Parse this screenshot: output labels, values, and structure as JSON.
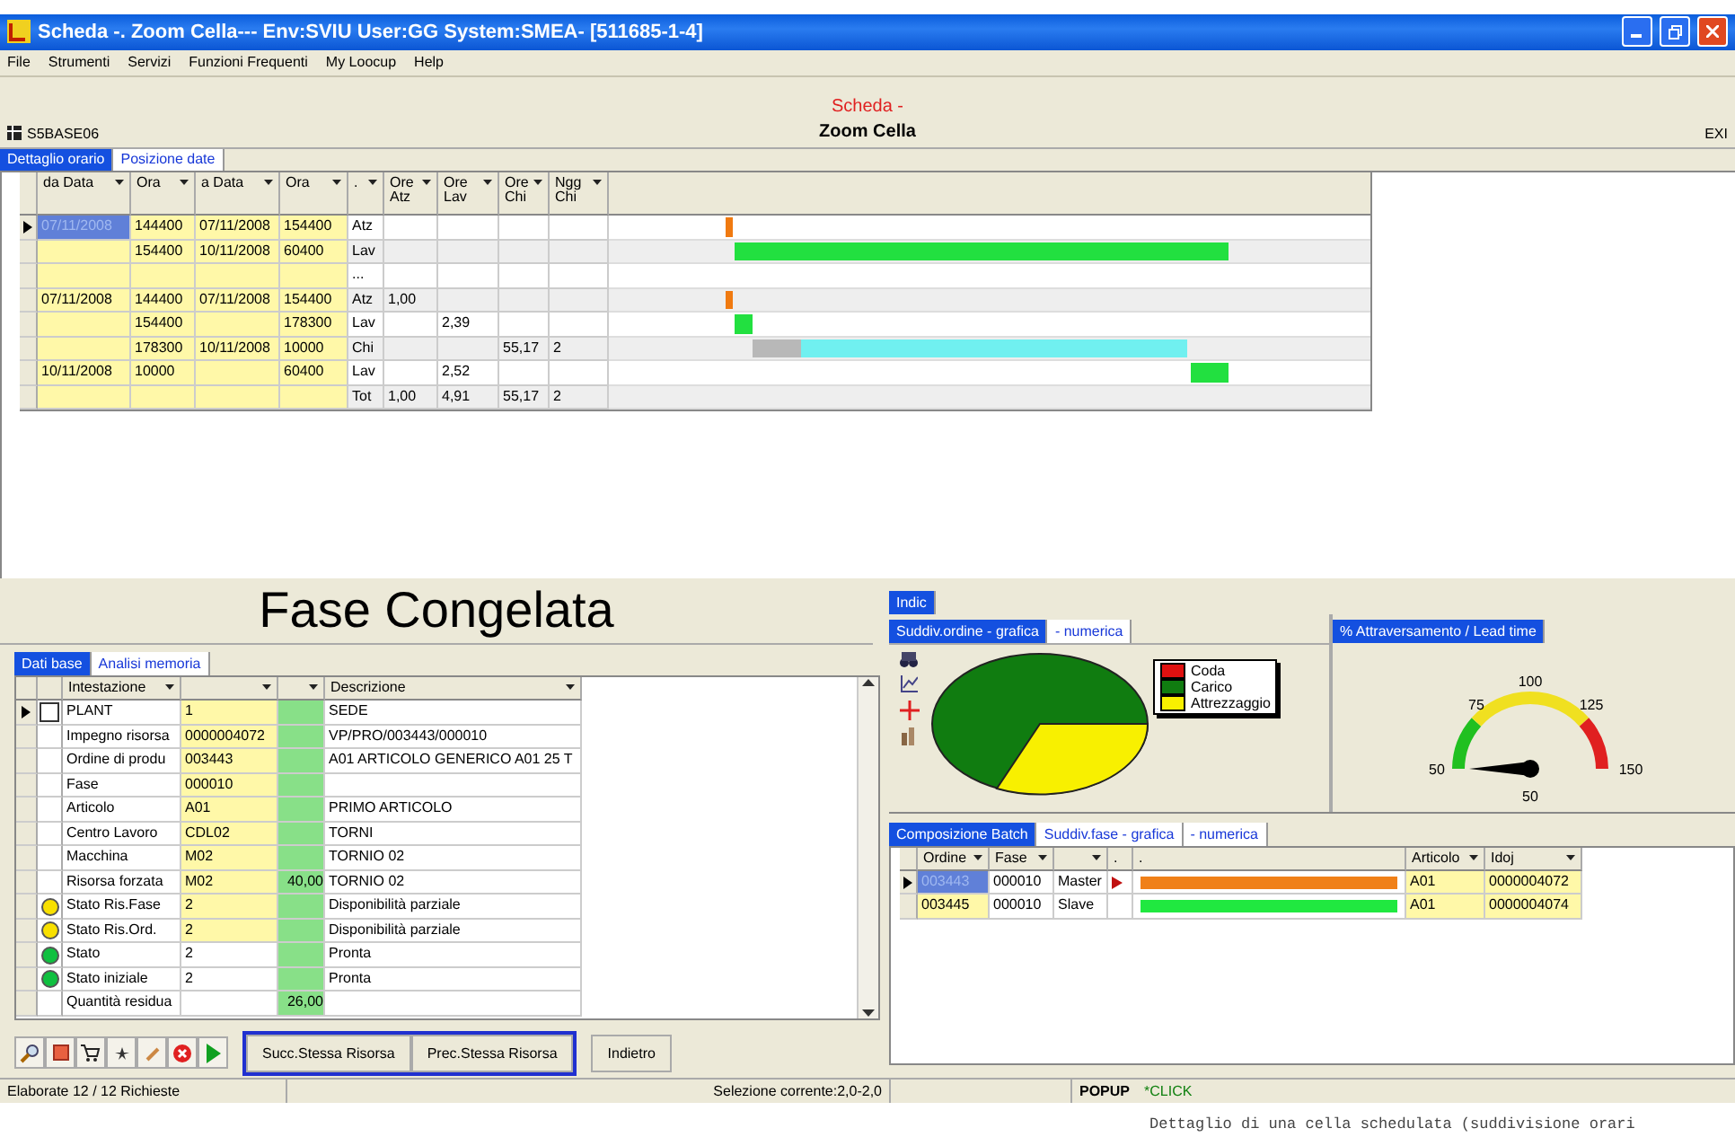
{
  "window": {
    "title": "Scheda -. Zoom Cella--- Env:SVIU User:GG System:SMEA- [511685-1-4]"
  },
  "menu": [
    "File",
    "Strumenti",
    "Servizi",
    "Funzioni Frequenti",
    "My Loocup",
    "Help"
  ],
  "header": {
    "code": "S5BASE06",
    "subtitle": "Scheda -",
    "title": "Zoom Cella",
    "exit": "EXI"
  },
  "top_tabs": [
    {
      "label": "Dettaglio orario",
      "selected": true
    },
    {
      "label": "Posizione date",
      "selected": false
    }
  ],
  "schedule": {
    "columns": [
      "da Data",
      "Ora",
      "a Data",
      "Ora",
      ".",
      "Ore Atz",
      "Ore Lav",
      "Ore Chi",
      "Ngg Chi"
    ],
    "rows": [
      {
        "selected": true,
        "cells": [
          "07/11/2008",
          "144400",
          "07/11/2008",
          "154400",
          "Atz",
          "",
          "",
          "",
          ""
        ],
        "bars": [
          {
            "color": "#f07a10"
          }
        ]
      },
      {
        "selected": false,
        "cells": [
          "",
          "154400",
          "10/11/2008",
          "60400",
          "Lav",
          "",
          "",
          "",
          ""
        ],
        "bars": [
          {
            "color": "#22e040"
          }
        ]
      },
      {
        "selected": false,
        "cells": [
          "",
          "",
          "",
          "",
          "...",
          "",
          "",
          "",
          ""
        ],
        "bars": []
      },
      {
        "selected": false,
        "cells": [
          "07/11/2008",
          "144400",
          "07/11/2008",
          "154400",
          "Atz",
          "1,00",
          "",
          "",
          ""
        ],
        "bars": [
          {
            "color": "#f07a10"
          }
        ]
      },
      {
        "selected": false,
        "cells": [
          "",
          "154400",
          "",
          "178300",
          "Lav",
          "",
          "2,39",
          "",
          ""
        ],
        "bars": [
          {
            "color": "#22e040"
          }
        ]
      },
      {
        "selected": false,
        "cells": [
          "",
          "178300",
          "10/11/2008",
          "10000",
          "Chi",
          "",
          "",
          "55,17",
          "2"
        ],
        "bars": [
          {
            "color": "#b8b8b8"
          },
          {
            "color": "#70f0f0"
          }
        ]
      },
      {
        "selected": false,
        "cells": [
          "10/11/2008",
          "10000",
          "",
          "60400",
          "Lav",
          "",
          "2,52",
          "",
          ""
        ],
        "bars": [
          {
            "color": "#22e040"
          }
        ]
      },
      {
        "selected": false,
        "cells": [
          "",
          "",
          "",
          "",
          "Tot",
          "1,00",
          "4,91",
          "55,17",
          "2"
        ],
        "bars": []
      }
    ]
  },
  "phase_title": "Fase Congelata",
  "detail_tabs": [
    {
      "label": "Dati base",
      "selected": true
    },
    {
      "label": "Analisi memoria",
      "selected": false
    }
  ],
  "detail": {
    "columns": [
      "Intestazione",
      "",
      "",
      "Descrizione"
    ],
    "rows": [
      {
        "selected": true,
        "kind": "checkbox",
        "checked": false,
        "label": "PLANT",
        "value": "1",
        "number": "",
        "description": "SEDE",
        "highlighted": true
      },
      {
        "selected": false,
        "kind": "plain",
        "label": "Impegno risorsa",
        "value": "0000004072",
        "number": "",
        "description": "VP/PRO/003443/000010",
        "highlighted": true
      },
      {
        "selected": false,
        "kind": "plain",
        "label": "Ordine di produ",
        "value": "003443",
        "number": "",
        "description": "A01 ARTICOLO GENERICO A01 25 T",
        "highlighted": true
      },
      {
        "selected": false,
        "kind": "plain",
        "label": "Fase",
        "value": "000010",
        "number": "",
        "description": "",
        "highlighted": true
      },
      {
        "selected": false,
        "kind": "plain",
        "label": "Articolo",
        "value": "A01",
        "number": "",
        "description": "PRIMO ARTICOLO",
        "highlighted": true
      },
      {
        "selected": false,
        "kind": "plain",
        "label": "Centro Lavoro",
        "value": "CDL02",
        "number": "",
        "description": "TORNI",
        "highlighted": true
      },
      {
        "selected": false,
        "kind": "plain",
        "label": "Macchina",
        "value": "M02",
        "number": "",
        "description": "TORNIO 02",
        "highlighted": true
      },
      {
        "selected": false,
        "kind": "plain",
        "label": "Risorsa forzata",
        "value": "M02",
        "number": "40,00",
        "description": "TORNIO 02",
        "highlighted": true
      },
      {
        "selected": false,
        "kind": "dot",
        "color": "#f8e000",
        "label": "Stato Ris.Fase",
        "value": "2",
        "number": "",
        "description": "Disponibilità parziale",
        "highlighted": true
      },
      {
        "selected": false,
        "kind": "dot",
        "color": "#f8e000",
        "label": "Stato Ris.Ord.",
        "value": "2",
        "number": "",
        "description": "Disponibilità parziale",
        "highlighted": true
      },
      {
        "selected": false,
        "kind": "dot",
        "color": "#10c040",
        "label": "Stato",
        "value": "2",
        "number": "",
        "description": "Pronta",
        "highlighted": false
      },
      {
        "selected": false,
        "kind": "dot",
        "color": "#10c040",
        "label": "Stato iniziale",
        "value": "2",
        "number": "",
        "description": "Pronta",
        "highlighted": false
      },
      {
        "selected": false,
        "kind": "plain",
        "label": "Quantità residua",
        "value": "",
        "number": "26,00",
        "description": "",
        "highlighted": false
      }
    ]
  },
  "buttons": [
    {
      "label": "Succ.Stessa Risorsa",
      "framed": true
    },
    {
      "label": "Prec.Stessa Risorsa",
      "framed": true
    },
    {
      "label": "Indietro",
      "framed": false
    }
  ],
  "status_bar": {
    "left": "Elaborate 12 / 12 Richieste",
    "middle": "Selezione corrente:2,0-2,0",
    "mode": "POPUP",
    "action": "*CLICK"
  },
  "index_tab": {
    "label": "Indic",
    "selected": true
  },
  "chart_tabs": [
    {
      "label": "Suddiv.ordine - grafica",
      "selected": true
    },
    {
      "label": "- numerica",
      "selected": false
    }
  ],
  "legend": [
    {
      "label": "Coda",
      "color": "#e01010"
    },
    {
      "label": "Carico",
      "color": "#107c10"
    },
    {
      "label": "Attrezzaggio",
      "color": "#f8f000"
    }
  ],
  "gauge": {
    "tab": "% Attraversamento / Lead time",
    "ticks": [
      "50",
      "75",
      "100",
      "125",
      "150"
    ],
    "reading": "50"
  },
  "batch_tabs": [
    {
      "label": "Composizione Batch",
      "selected": true
    },
    {
      "label": "Suddiv.fase - grafica",
      "selected": false
    },
    {
      "label": "- numerica",
      "selected": false
    }
  ],
  "batch": {
    "columns": [
      "Ordine",
      "Fase",
      "",
      ".",
      ".",
      "Articolo",
      "Idoj"
    ],
    "rows": [
      {
        "selected": true,
        "order": "003443",
        "phase": "000010",
        "role": "Master",
        "marker": true,
        "color": "#f08018",
        "article": "A01",
        "id": "0000004072"
      },
      {
        "selected": false,
        "order": "003445",
        "phase": "000010",
        "role": "Slave",
        "marker": false,
        "color": "#20e840",
        "article": "A01",
        "id": "0000004074"
      }
    ]
  },
  "caption": "Dettaglio di una cella schedulata (suddivisione orari"
}
